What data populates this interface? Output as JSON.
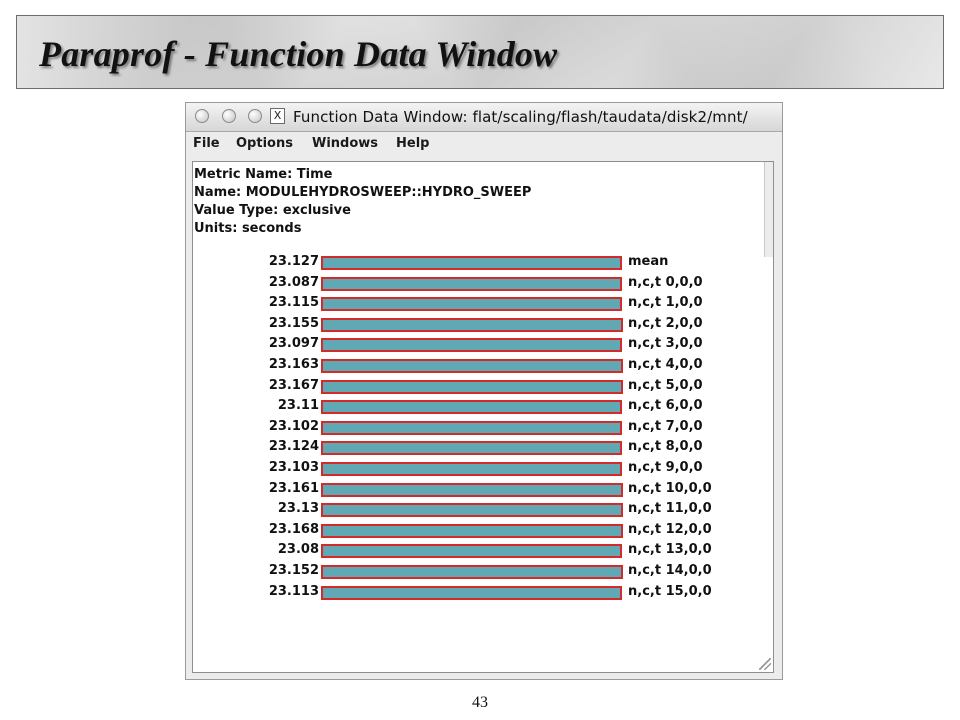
{
  "slide": {
    "title": "Paraprof - Function Data Window",
    "page_number": "43"
  },
  "window": {
    "title": "Function Data Window: flat/scaling/flash/taudata/disk2/mnt/",
    "close_glyph": "X",
    "menu": [
      "File",
      "Options",
      "Windows",
      "Help"
    ]
  },
  "info": {
    "metric_name": "Metric Name: Time",
    "name": "Name: MODULEHYDROSWEEP::HYDRO_SWEEP",
    "value_type": "Value Type: exclusive",
    "units": "Units: seconds"
  },
  "chart_data": {
    "type": "bar",
    "orientation": "horizontal",
    "value_units": "seconds",
    "bar_fill": "#5fa8b4",
    "bar_outline": "#d42a2a",
    "rows": [
      {
        "label": "mean",
        "value_text": "23.127",
        "value": 23.127
      },
      {
        "label": "n,c,t 0,0,0",
        "value_text": "23.087",
        "value": 23.087
      },
      {
        "label": "n,c,t 1,0,0",
        "value_text": "23.115",
        "value": 23.115
      },
      {
        "label": "n,c,t 2,0,0",
        "value_text": "23.155",
        "value": 23.155
      },
      {
        "label": "n,c,t 3,0,0",
        "value_text": "23.097",
        "value": 23.097
      },
      {
        "label": "n,c,t 4,0,0",
        "value_text": "23.163",
        "value": 23.163
      },
      {
        "label": "n,c,t 5,0,0",
        "value_text": "23.167",
        "value": 23.167
      },
      {
        "label": "n,c,t 6,0,0",
        "value_text": "23.11",
        "value": 23.11
      },
      {
        "label": "n,c,t 7,0,0",
        "value_text": "23.102",
        "value": 23.102
      },
      {
        "label": "n,c,t 8,0,0",
        "value_text": "23.124",
        "value": 23.124
      },
      {
        "label": "n,c,t 9,0,0",
        "value_text": "23.103",
        "value": 23.103
      },
      {
        "label": "n,c,t 10,0,0",
        "value_text": "23.161",
        "value": 23.161
      },
      {
        "label": "n,c,t 11,0,0",
        "value_text": "23.13",
        "value": 23.13
      },
      {
        "label": "n,c,t 12,0,0",
        "value_text": "23.168",
        "value": 23.168
      },
      {
        "label": "n,c,t 13,0,0",
        "value_text": "23.08",
        "value": 23.08
      },
      {
        "label": "n,c,t 14,0,0",
        "value_text": "23.152",
        "value": 23.152
      },
      {
        "label": "n,c,t 15,0,0",
        "value_text": "23.113",
        "value": 23.113
      }
    ]
  }
}
